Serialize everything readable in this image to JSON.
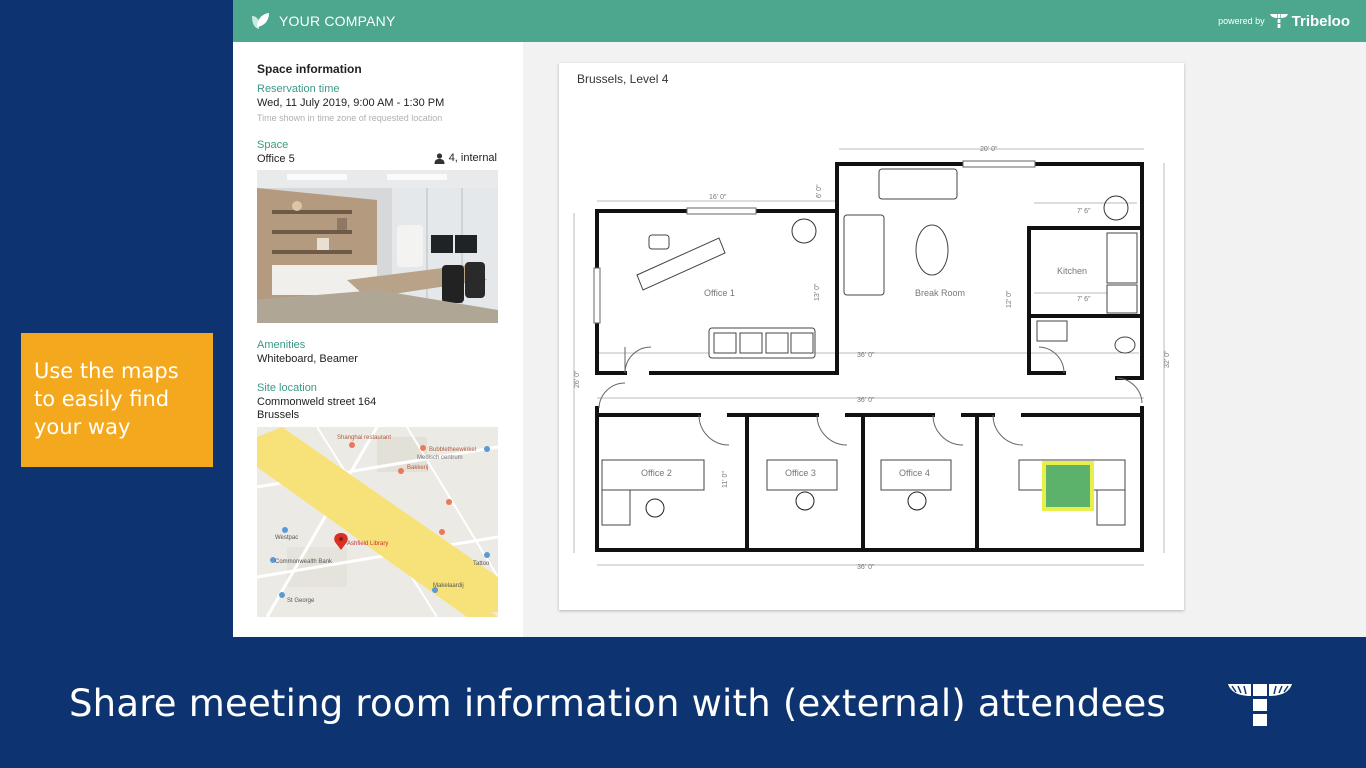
{
  "header": {
    "company_name": "YOUR COMPANY",
    "powered_by": "powered by",
    "vendor_name": "Tribeloo",
    "color": "#4da68e"
  },
  "sidebar": {
    "title": "Space information",
    "reservation_label": "Reservation time",
    "reservation_value": "Wed, 11 July 2019, 9:00 AM - 1:30 PM",
    "timezone_hint": "Time shown in time zone of requested location",
    "space_label": "Space",
    "space_name": "Office 5",
    "capacity": "4, internal",
    "amenities_label": "Amenities",
    "amenities_value": "Whiteboard, Beamer",
    "site_label": "Site location",
    "address_line1": "Commonweld street 164",
    "address_line2": "Brussels"
  },
  "map": {
    "labels": {
      "shanghai": "Shanghai restaurant",
      "bubble": "Bubbletheewinkel",
      "medisch": "Medisch centrum",
      "bakkerij": "Bakkerij",
      "westpac": "Westpac",
      "commonwealth": "Commonwealth Bank",
      "library": "Ashfield Library",
      "tattoo": "Tattoo",
      "makelaardij": "Makelaardij",
      "stgeorge": "St George"
    },
    "road_color": "#f7e27a",
    "pin_color": "#d93025"
  },
  "floorplan": {
    "title": "Brussels, Level 4",
    "rooms": {
      "office1": "Office 1",
      "break_room": "Break Room",
      "kitchen": "Kitchen",
      "office2": "Office 2",
      "office3": "Office 3",
      "office4": "Office 4"
    },
    "dimensions": {
      "top_right": "20' 0\"",
      "top_left": "16' 0\"",
      "office1_height": "13' 0\"",
      "left_wall": "26' 0\"",
      "corridor_top": "36' 0\"",
      "corridor_mid": "36' 0\"",
      "bottom": "36' 0\"",
      "kitchen_top": "7' 6\"",
      "kitchen_mid": "7' 6\"",
      "right_wall": "32' 0\"",
      "break_height": "12' 0\"",
      "office2_height": "11' 0\"",
      "left_upper": "6' 0\""
    },
    "highlight_color": "#5cb26a",
    "highlight_glow": "#e9ef4a"
  },
  "callout": {
    "line1": "Use the maps",
    "line2": "to easily find",
    "line3": "your way",
    "color": "#f4a81d"
  },
  "caption": "Share meeting room information with (external) attendees"
}
